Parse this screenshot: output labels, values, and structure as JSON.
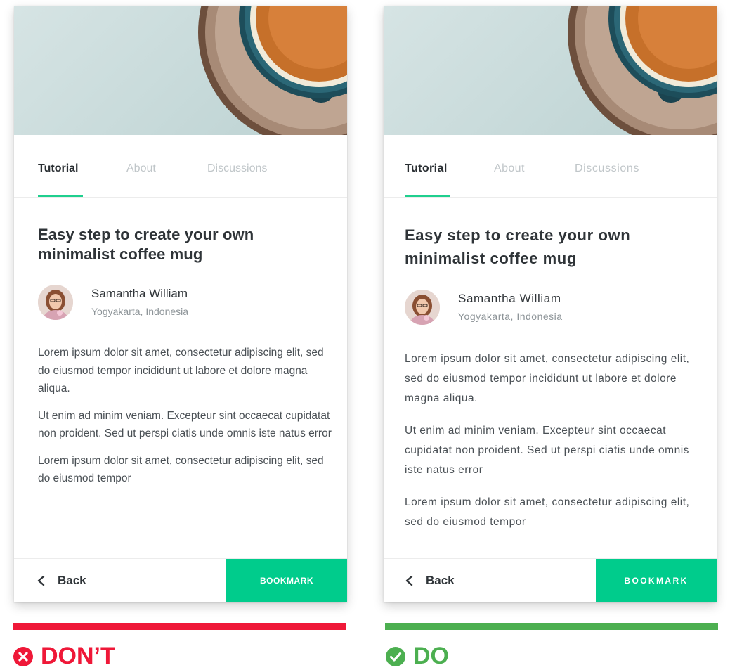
{
  "colors": {
    "accent_green": "#00cc8c",
    "tab_indicator": "#1fcf8e",
    "dont_red": "#ef1838",
    "do_green": "#4caf50"
  },
  "tabs": [
    "Tutorial",
    "About",
    "Discussions"
  ],
  "active_tab": "Tutorial",
  "article": {
    "title_line1": "Easy step to create your own",
    "title_line2": "minimalist coffee mug",
    "author_name": "Samantha William",
    "author_location": "Yogyakarta, Indonesia"
  },
  "dont_card": {
    "paragraphs": [
      "Lorem ipsum dolor sit amet, consectetur adipiscing elit, sed do eiusmod tempor incididunt ut labore et dolore magna aliqua.",
      "Ut enim ad minim veniam. Excepteur sint occaecat cupidatat non proident. Sed ut perspi ciatis unde omnis iste natus error",
      "Lorem ipsum dolor sit amet, consectetur adipiscing elit, sed do eiusmod tempor"
    ]
  },
  "do_card": {
    "paragraphs": [
      "Lorem ipsum dolor sit amet, consectetur adipiscing elit, sed do eiusmod tempor incididunt ut labore et dolore magna aliqua.",
      "Ut enim ad minim veniam. Excepteur sint occaecat cupidatat non proident. Sed ut perspi ciatis unde omnis iste natus error",
      "Lorem ipsum dolor sit amet, consectetur adipiscing elit, sed do eiusmod tempor"
    ]
  },
  "footer": {
    "back_label": "Back",
    "bookmark_label": "BOOKMARK"
  },
  "verdicts": {
    "dont_label": "DON’T",
    "dont_icon": "x-circle-icon",
    "do_label": "DO",
    "do_icon": "check-circle-icon"
  }
}
